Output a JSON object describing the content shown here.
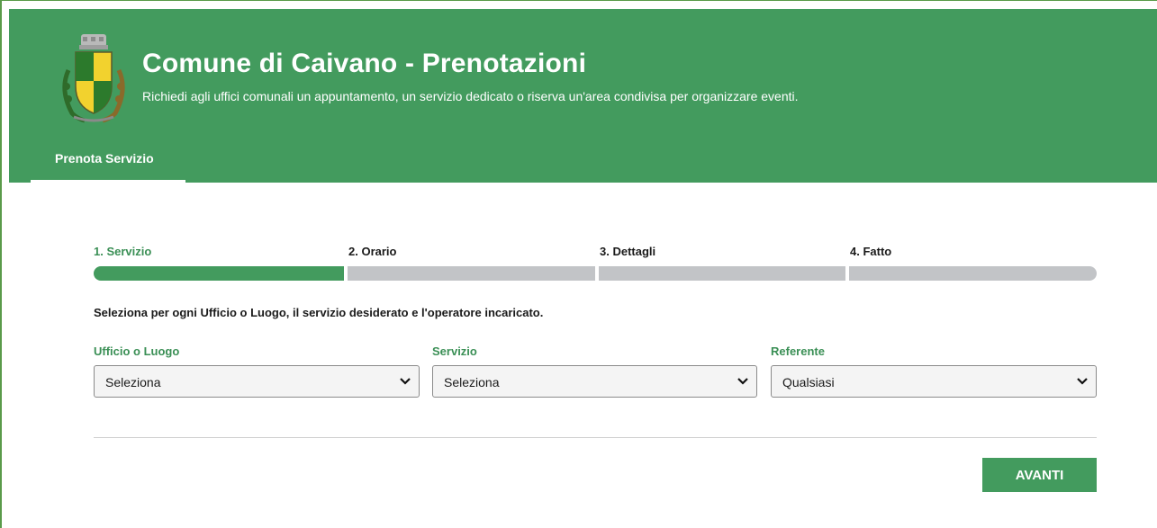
{
  "header": {
    "title": "Comune di Caivano - Prenotazioni",
    "subtitle": "Richiedi agli uffici comunali un appuntamento, un servizio dedicato o riserva un'area condivisa per organizzare eventi.",
    "logo_icon": "municipal-coat-of-arms-icon",
    "brand_color": "#439b5e"
  },
  "nav": {
    "active_tab": "Prenota Servizio"
  },
  "wizard": {
    "steps": [
      "1. Servizio",
      "2. Orario",
      "3. Dettagli",
      "4. Fatto"
    ],
    "current_step": 1,
    "progress_fraction": 0.25
  },
  "form": {
    "instruction": "Seleziona per ogni Ufficio o Luogo, il servizio desiderato e l'operatore incaricato.",
    "fields": [
      {
        "label": "Ufficio o Luogo",
        "value": "Seleziona"
      },
      {
        "label": "Servizio",
        "value": "Seleziona"
      },
      {
        "label": "Referente",
        "value": "Qualsiasi"
      }
    ]
  },
  "actions": {
    "next_label": "AVANTI"
  }
}
